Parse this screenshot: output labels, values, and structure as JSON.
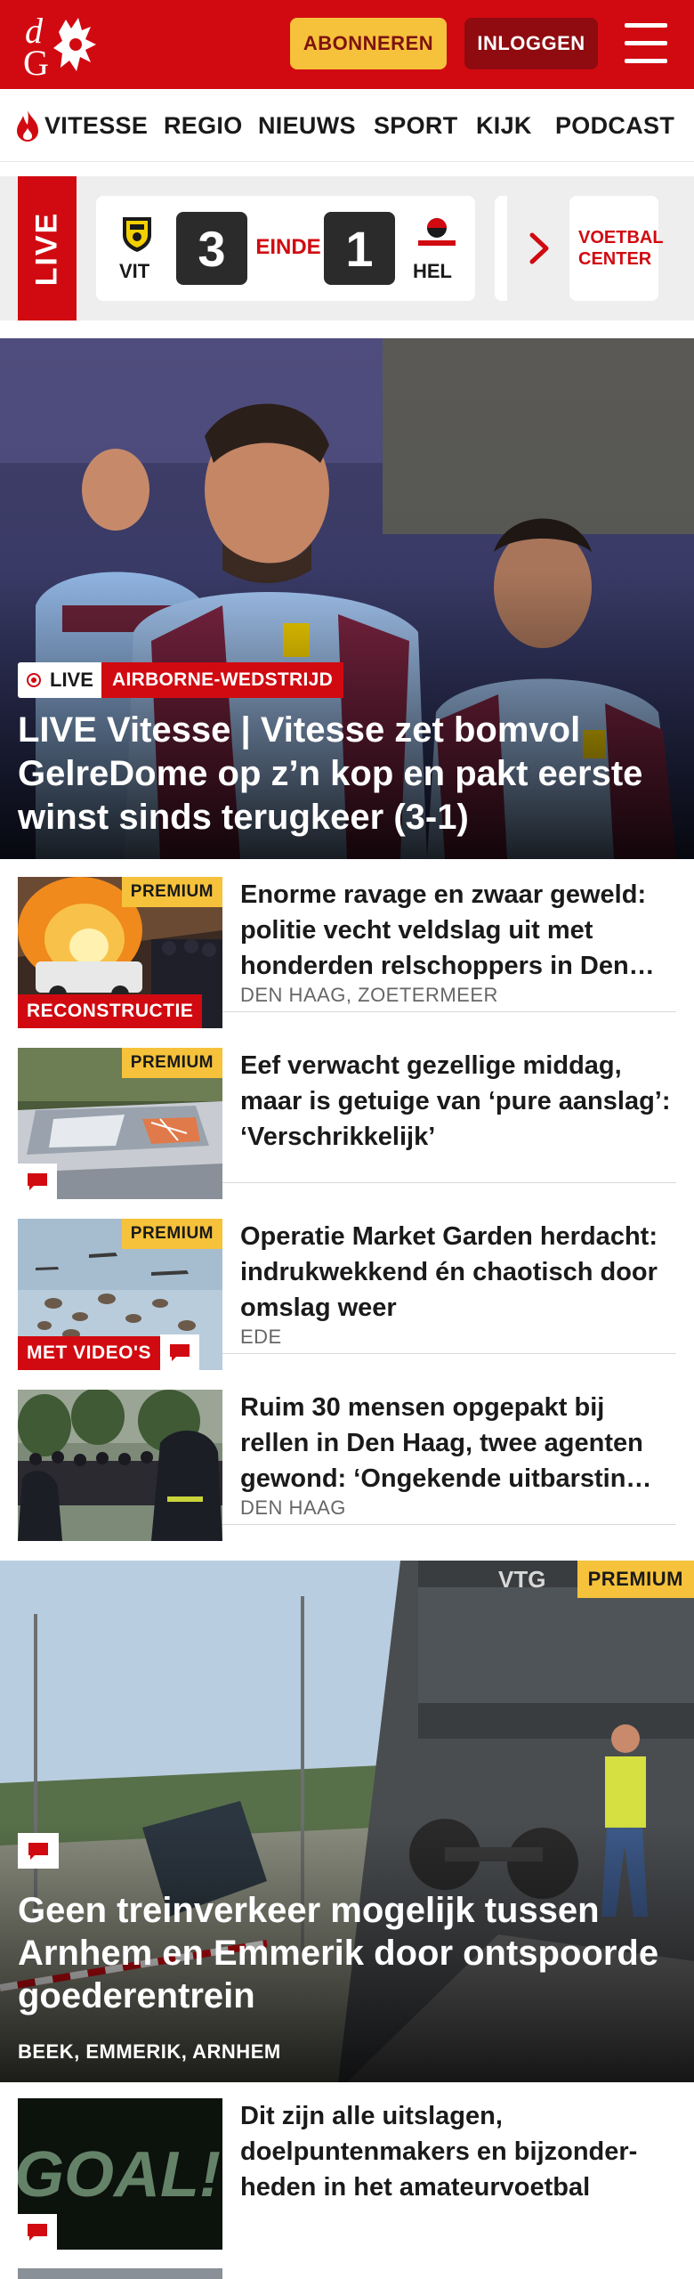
{
  "header": {
    "subscribe_label": "ABONNEREN",
    "login_label": "INLOGGEN",
    "brand_color": "#d10a11",
    "accent_color": "#f6c23b"
  },
  "nav": {
    "items": [
      "VITESSE",
      "REGIO",
      "NIEUWS",
      "SPORT",
      "KIJK",
      "PODCAST"
    ]
  },
  "scoreboard": {
    "live_label": "LIVE",
    "home_code": "VIT",
    "away_code": "HEL",
    "home_score": "3",
    "away_score": "1",
    "status": "EINDE",
    "football_center": "VOETBAL CENTER"
  },
  "hero": {
    "live_badge": "LIVE",
    "category": "AIRBORNE-WEDSTRIJD",
    "title": "LIVE Vitesse | Vitesse zet bomvol GelreDome op z’n kop en pakt eerste winst sinds terugkeer (3-1)"
  },
  "articles": [
    {
      "premium": "PREMIUM",
      "label": "RECONSTRUCTIE",
      "title": "Enorme ravage en zwaar geweld: politie vecht veldslag uit met honderden relschoppers in Den…",
      "location": "DEN HAAG, ZOETERMEER"
    },
    {
      "premium": "PREMIUM",
      "title": "Eef verwacht gezellige middag, maar is getuige van ‘pure aanslag’: ‘Verschrikkelijk’"
    },
    {
      "premium": "PREMIUM",
      "label": "MET VIDEO'S",
      "title": "Operatie Market Garden herdacht: indrukwekkend én chaotisch door omslag weer",
      "location": "EDE"
    },
    {
      "title": "Ruim 30 mensen opgepakt bij rellen in Den Haag, twee agenten gewond: ‘Ongekende uitbarstin…",
      "location": "DEN HAAG"
    }
  ],
  "feature": {
    "premium": "PREMIUM",
    "title": "Geen treinverkeer mogelijk tussen Arnhem en Emmerik door ontspoorde goederentrein",
    "location": "BEEK, EMMERIK, ARNHEM"
  },
  "articles_bottom": [
    {
      "thumb_text": "GOAL!",
      "title": "Dit zijn alle uitslagen, doelpuntenmakers en bijzonder-heden in het amateurvoetbal"
    }
  ]
}
